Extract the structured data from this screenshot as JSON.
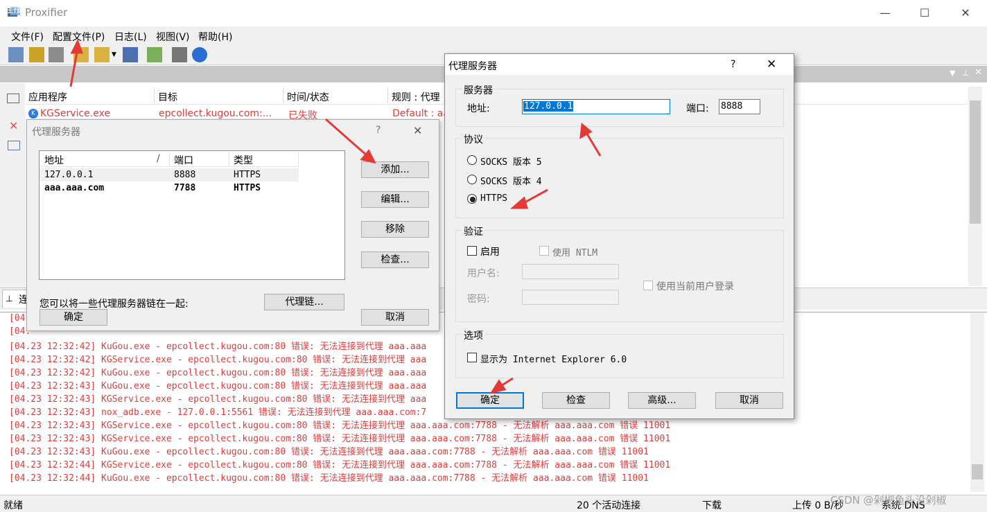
{
  "app": {
    "title": "Proxifier",
    "min": "—",
    "max": "☐",
    "close": "✕"
  },
  "menu": [
    "文件(F)",
    "配置文件(P)",
    "日志(L)",
    "视图(V)",
    "帮助(H)"
  ],
  "conn": {
    "label": "连接",
    "headers": [
      "应用程序",
      "目标",
      "时间/状态",
      "规则 : 代理"
    ],
    "row": {
      "app": "KGService.exe",
      "target": "epcollect.kugou.com:...",
      "status": "已失败",
      "rule": "Default : aa"
    }
  },
  "tab": "连",
  "log": [
    "[04.",
    "[04.",
    "[04.23 12:32:42] KuGou.exe - epcollect.kugou.com:80 错误: 无法连接到代理 aaa.aaa",
    "[04.23 12:32:42] KGService.exe - epcollect.kugou.com:80 错误: 无法连接到代理 aaa",
    "[04.23 12:32:42] KuGou.exe - epcollect.kugou.com:80 错误: 无法连接到代理 aaa.aaa",
    "[04.23 12:32:43] KuGou.exe - epcollect.kugou.com:80 错误: 无法连接到代理 aaa.aaa",
    "[04.23 12:32:43] KGService.exe - epcollect.kugou.com:80 错误: 无法连接到代理 aaa",
    "[04.23 12:32:43] nox_adb.exe - 127.0.0.1:5561 错误: 无法连接到代理 aaa.aaa.com:7",
    "[04.23 12:32:43] KGService.exe - epcollect.kugou.com:80 错误: 无法连接到代理 aaa.aaa.com:7788 - 无法解析 aaa.aaa.com 错误 11001",
    "[04.23 12:32:43] KGService.exe - epcollect.kugou.com:80 错误: 无法连接到代理 aaa.aaa.com:7788 - 无法解析 aaa.aaa.com 错误 11001",
    "[04.23 12:32:43] KuGou.exe - epcollect.kugou.com:80 错误: 无法连接到代理 aaa.aaa.com:7788 - 无法解析 aaa.aaa.com 错误 11001",
    "[04.23 12:32:44] KGService.exe - epcollect.kugou.com:80 错误: 无法连接到代理 aaa.aaa.com:7788 - 无法解析 aaa.aaa.com 错误 11001",
    "[04.23 12:32:44] KuGou.exe - epcollect.kugou.com:80 错误: 无法连接到代理 aaa.aaa.com:7788 - 无法解析 aaa.aaa.com 错误 11001"
  ],
  "status": {
    "ready": "就绪",
    "active": "20 个活动连接",
    "download": "下载",
    "upload": "上传 0 B/秒",
    "dns": "系统 DNS",
    "watermark": "CSDN @剁椒鱼头没剁椒"
  },
  "dlg1": {
    "title": "代理服务器",
    "help": "?",
    "close": "✕",
    "cols": [
      "地址",
      "/",
      "端口",
      "类型"
    ],
    "rows": [
      [
        "127.0.0.1",
        "8888",
        "HTTPS"
      ],
      [
        "aaa.aaa.com",
        "7788",
        "HTTPS"
      ]
    ],
    "add": "添加...",
    "edit": "编辑...",
    "remove": "移除",
    "check": "检查...",
    "chain_text": "您可以将一些代理服务器链在一起:",
    "chain": "代理链...",
    "ok": "确定",
    "cancel": "取消"
  },
  "dlg2": {
    "title": "代理服务器",
    "help": "?",
    "close": "✕",
    "server_group": "服务器",
    "addr_label": "地址:",
    "addr_value": "127.0.0.1",
    "port_label": "端口:",
    "port_value": "8888",
    "proto_group": "协议",
    "socks5": "SOCKS 版本 5",
    "socks4": "SOCKS 版本 4",
    "https": "HTTPS",
    "auth_group": "验证",
    "enable": "启用",
    "ntlm": "使用 NTLM",
    "user_label": "用户名:",
    "pass_label": "密码:",
    "current_user": "使用当前用户登录",
    "opt_group": "选项",
    "ie": "显示为 Internet Explorer 6.0",
    "ok": "确定",
    "check": "检查",
    "advanced": "高级...",
    "cancel": "取消"
  }
}
